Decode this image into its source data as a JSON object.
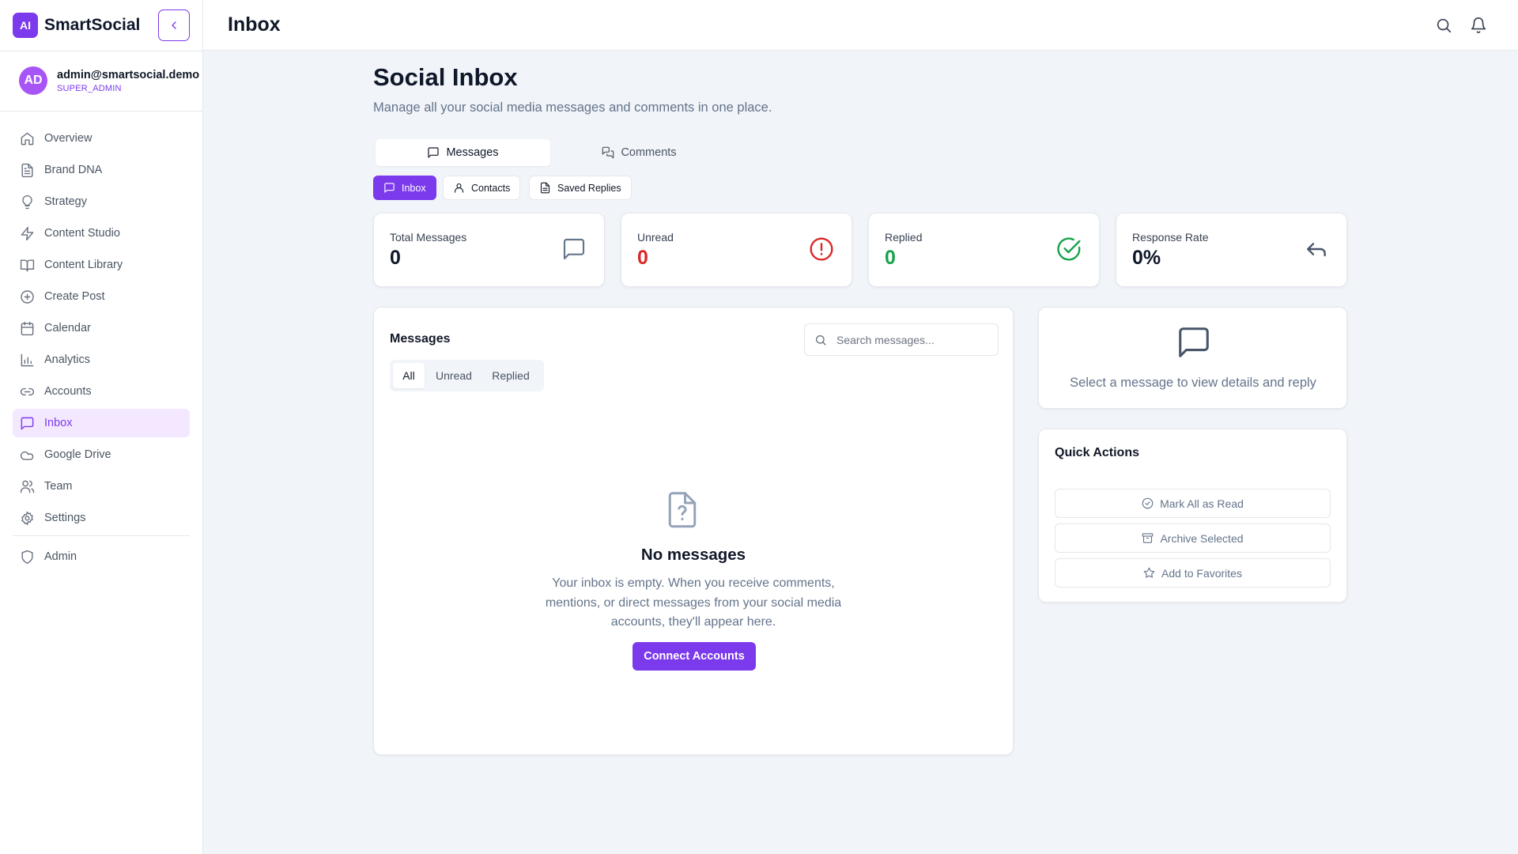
{
  "brand": {
    "logo_text": "AI",
    "name": "SmartSocial"
  },
  "user": {
    "initials": "AD",
    "email": "admin@smartsocial.demo",
    "role": "SUPER_ADMIN"
  },
  "sidebar": {
    "items": [
      {
        "label": "Overview",
        "icon": "home-icon"
      },
      {
        "label": "Brand DNA",
        "icon": "document-icon"
      },
      {
        "label": "Strategy",
        "icon": "lightbulb-icon"
      },
      {
        "label": "Content Studio",
        "icon": "lightning-icon"
      },
      {
        "label": "Content Library",
        "icon": "book-icon"
      },
      {
        "label": "Create Post",
        "icon": "plus-circle-icon"
      },
      {
        "label": "Calendar",
        "icon": "calendar-icon"
      },
      {
        "label": "Analytics",
        "icon": "bar-chart-icon"
      },
      {
        "label": "Accounts",
        "icon": "link-icon"
      },
      {
        "label": "Inbox",
        "icon": "message-square-icon",
        "active": true
      },
      {
        "label": "Google Drive",
        "icon": "cloud-icon"
      },
      {
        "label": "Team",
        "icon": "users-icon"
      },
      {
        "label": "Settings",
        "icon": "gear-icon"
      }
    ],
    "admin": {
      "label": "Admin",
      "icon": "shield-icon"
    }
  },
  "topbar": {
    "title": "Inbox"
  },
  "page": {
    "title": "Social Inbox",
    "subtitle": "Manage all your social media messages and comments in one place."
  },
  "main_tabs": [
    {
      "label": "Messages",
      "active": true
    },
    {
      "label": "Comments",
      "active": false
    }
  ],
  "sub_tabs": [
    {
      "label": "Inbox",
      "active": true
    },
    {
      "label": "Contacts",
      "active": false
    },
    {
      "label": "Saved Replies",
      "active": false
    }
  ],
  "stats": [
    {
      "label": "Total Messages",
      "value": "0",
      "color": "#0f172a",
      "icon": "message-square-icon"
    },
    {
      "label": "Unread",
      "value": "0",
      "color": "#dc2626",
      "icon": "alert-circle-icon"
    },
    {
      "label": "Replied",
      "value": "0",
      "color": "#16a34a",
      "icon": "check-circle-icon"
    },
    {
      "label": "Response Rate",
      "value": "0%",
      "color": "#0f172a",
      "icon": "reply-icon"
    }
  ],
  "messages_panel": {
    "title": "Messages",
    "search_placeholder": "Search messages...",
    "filters": [
      "All",
      "Unread",
      "Replied"
    ],
    "empty_title": "No messages",
    "empty_description": "Your inbox is empty. When you receive comments, mentions, or direct messages from your social media accounts, they'll appear here.",
    "connect_button": "Connect Accounts"
  },
  "detail_panel": {
    "text": "Select a message to view details and reply"
  },
  "quick_actions": {
    "title": "Quick Actions",
    "buttons": [
      "Mark All as Read",
      "Archive Selected",
      "Add to Favorites"
    ]
  },
  "colors": {
    "accent": "#7c3aed",
    "unread": "#dc2626",
    "replied": "#16a34a",
    "background": "#f1f4f9"
  }
}
